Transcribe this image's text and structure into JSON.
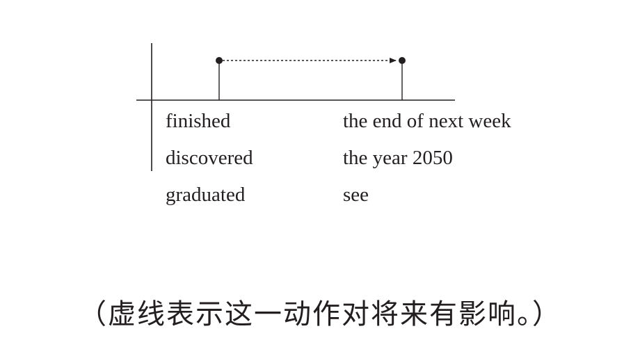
{
  "diagram": {
    "rows": [
      {
        "left": "finished",
        "right": "the end of next week"
      },
      {
        "left": "discovered",
        "right": "the year 2050"
      },
      {
        "left": "graduated",
        "right": "see"
      }
    ]
  },
  "caption": "（虚线表示这一动作对将来有影响。）"
}
